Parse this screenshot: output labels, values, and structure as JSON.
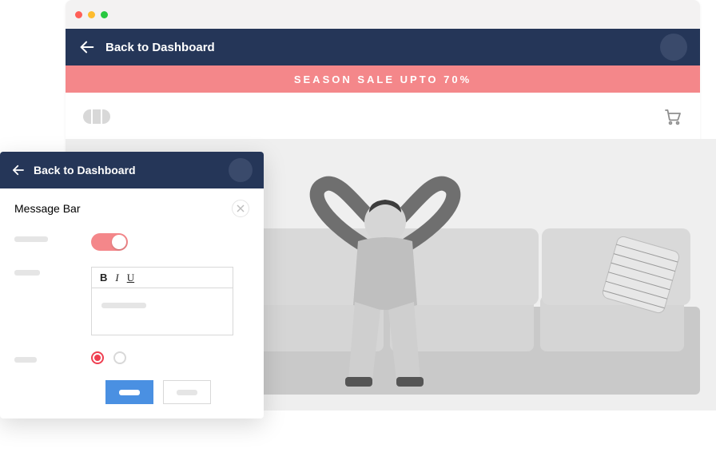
{
  "main": {
    "back_label": "Back to Dashboard",
    "promo_text": "SEASON SALE UPTO 70%"
  },
  "panel": {
    "back_label": "Back to Dashboard",
    "title": "Message Bar",
    "bold": "B",
    "italic": "I",
    "underline": "U"
  },
  "colors": {
    "navy": "#253658",
    "salmon": "#f4878a",
    "toggle_on": "#f4878a",
    "primary": "#4a90e2",
    "radio_selected": "#ef3f51"
  }
}
